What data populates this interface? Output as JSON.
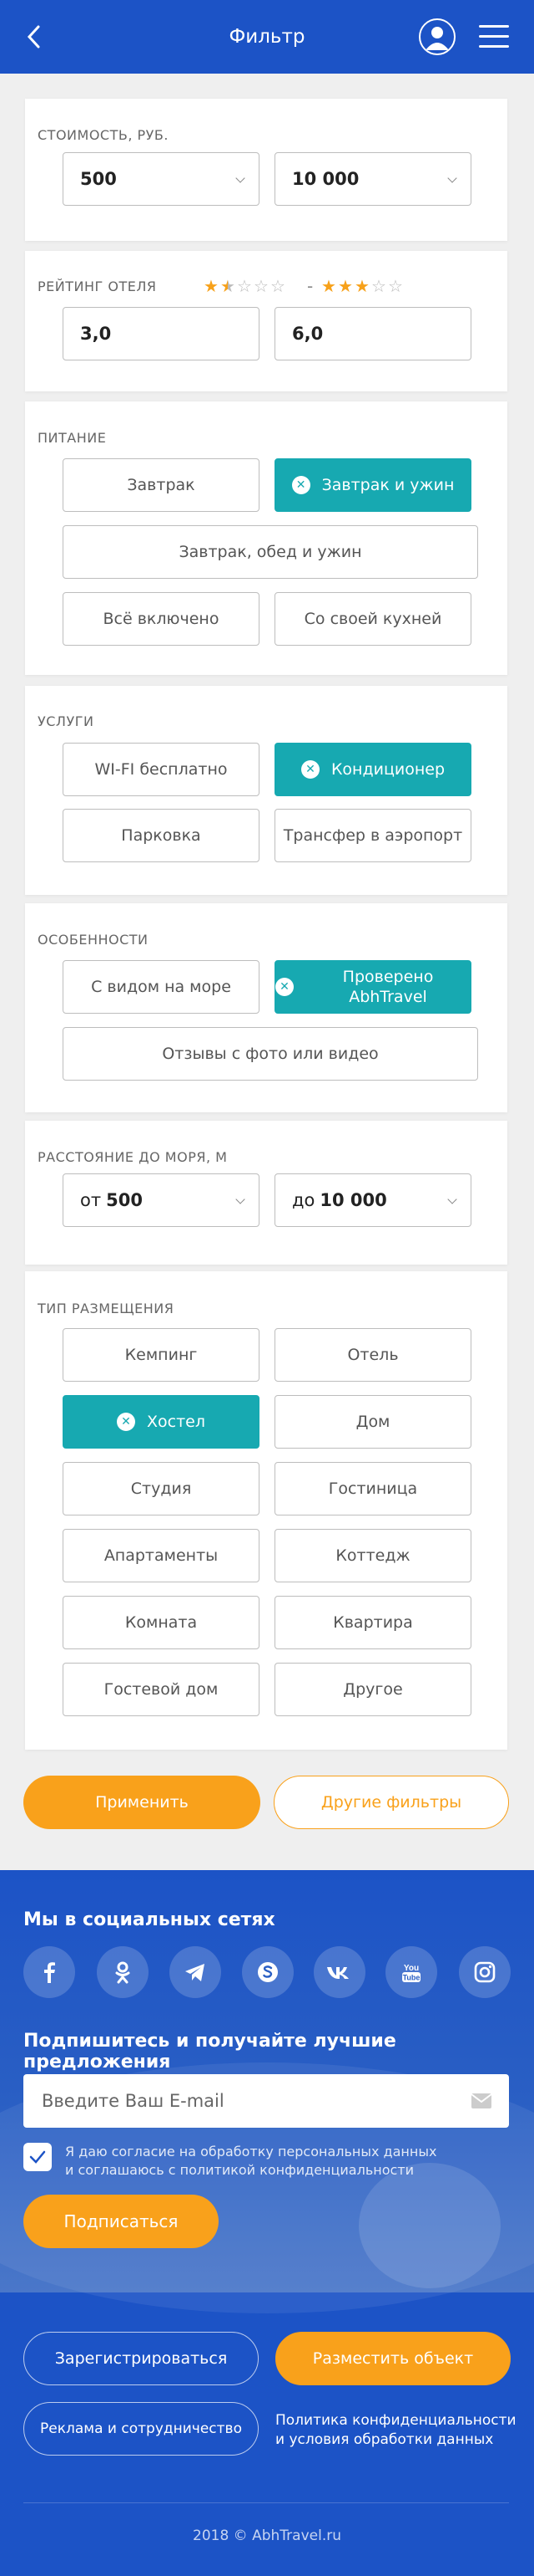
{
  "header": {
    "title": "Фильтр"
  },
  "price": {
    "label": "Стоимость, руб.",
    "from": "500",
    "to": "10 000"
  },
  "rating": {
    "label": "Рейтинг отеля",
    "from_value": "3,0",
    "to_value": "6,0",
    "from_stars": 1.5,
    "to_stars": 3,
    "separator": "-"
  },
  "food": {
    "label": "Питание",
    "options": [
      "Завтрак",
      "Завтрак и ужин",
      "Завтрак, обед и ужин",
      "Всё включено",
      "Со своей кухней"
    ],
    "selected": [
      "Завтрак и ужин"
    ]
  },
  "services": {
    "label": "Услуги",
    "options": [
      "WI-FI бесплатно",
      "Кондиционер",
      "Парковка",
      "Трансфер в аэропорт"
    ],
    "selected": [
      "Кондиционер"
    ]
  },
  "features": {
    "label": "Особенности",
    "options": [
      "С видом на море",
      "Проверено AbhTravel",
      "Отзывы с фото или видео"
    ],
    "selected": [
      "Проверено AbhTravel"
    ]
  },
  "distance": {
    "label": "Расстояние до моря, м",
    "from_prefix": "от",
    "from": "500",
    "to_prefix": "до",
    "to": "10 000"
  },
  "accommodation": {
    "label": "Тип размещения",
    "options": [
      "Кемпинг",
      "Отель",
      "Хостел",
      "Дом",
      "Студия",
      "Гостиница",
      "Апартаменты",
      "Коттедж",
      "Комната",
      "Квартира",
      "Гостевой дом",
      "Другое"
    ],
    "selected": [
      "Хостел"
    ]
  },
  "actions": {
    "apply": "Применить",
    "other_filters": "Другие фильтры"
  },
  "footer": {
    "social_title": "Мы в социальных сетях",
    "social_icons": [
      "facebook-icon",
      "odnoklassniki-icon",
      "telegram-icon",
      "skype-icon",
      "vk-icon",
      "youtube-icon",
      "instagram-icon"
    ],
    "subscribe_title": "Подпишитесь и получайте лучшие предложения",
    "email_placeholder": "Введите Ваш E-mail",
    "consent": "Я даю согласие на обработку персональных данных и соглашаюсь с политикой конфиденциальности",
    "consent_checked": true,
    "subscribe_button": "Подписаться",
    "register": "Зарегистрироваться",
    "place_object": "Разместить объект",
    "ads": "Реклама и сотрудничество",
    "policy": "Политика конфиденциальности и условия обработки данных",
    "copyright": "2018 © AbhTravel.ru"
  },
  "colors": {
    "primary": "#1c53c6",
    "accent": "#f9a11b",
    "selected": "#17a9b1"
  }
}
